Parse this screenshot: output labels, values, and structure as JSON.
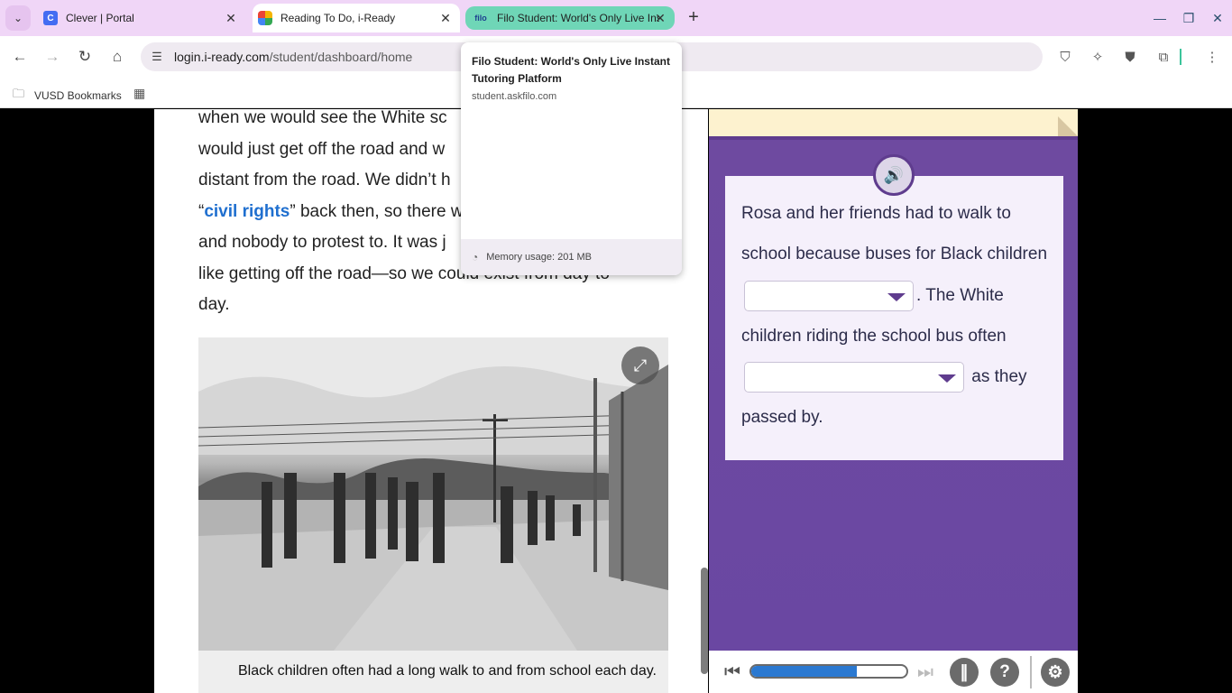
{
  "browser": {
    "tabs": [
      {
        "title": "Clever | Portal",
        "favicon": "clever-favicon",
        "active": false
      },
      {
        "title": "Reading To Do, i-Ready",
        "favicon": "iready-favicon",
        "active": true
      },
      {
        "title": "Filo Student: World's Only Live Instant Tutoring Platform",
        "favicon": "filo-favicon",
        "favicon_text": "filo",
        "active": false
      }
    ],
    "url_domain": "login.i-ready.com",
    "url_path": "/student/dashboard/home",
    "bookmarks": [
      {
        "label": "VUSD Bookmarks",
        "icon": "folder-icon"
      }
    ]
  },
  "hovercard": {
    "title": "Filo Student: World's Only Live Instant Tutoring Platform",
    "domain": "student.askfilo.com",
    "memory": "Memory usage: 201 MB"
  },
  "passage": {
    "line1": "when we would see the White sc",
    "line2": "would just get off the road and w",
    "line3": "distant from the road. We didn’t h",
    "line4_open": "“",
    "line4_keyword": "civil rights",
    "line4_rest": "” back then, so there w",
    "line5": "and nobody to protest to. It was j",
    "line6": "like getting off the road—so we could exist from day to",
    "line7": "day.",
    "caption": "Black children often had a long walk to and from school each day."
  },
  "question": {
    "part1": "Rosa and her friends had to walk to school because buses for Black children",
    "part2": ". The White children riding the school bus often",
    "part3": "as they passed by.",
    "dropdown1_value": "",
    "dropdown2_value": ""
  },
  "player": {
    "progress": 0.68,
    "help_label": "?"
  },
  "colors": {
    "panel_purple": "#6e4aa0",
    "keyword_blue": "#1f6fcf",
    "progress_blue": "#2b79d1",
    "tab_strip": "#f0d6f7",
    "filo_tab": "#6fd6b7"
  }
}
